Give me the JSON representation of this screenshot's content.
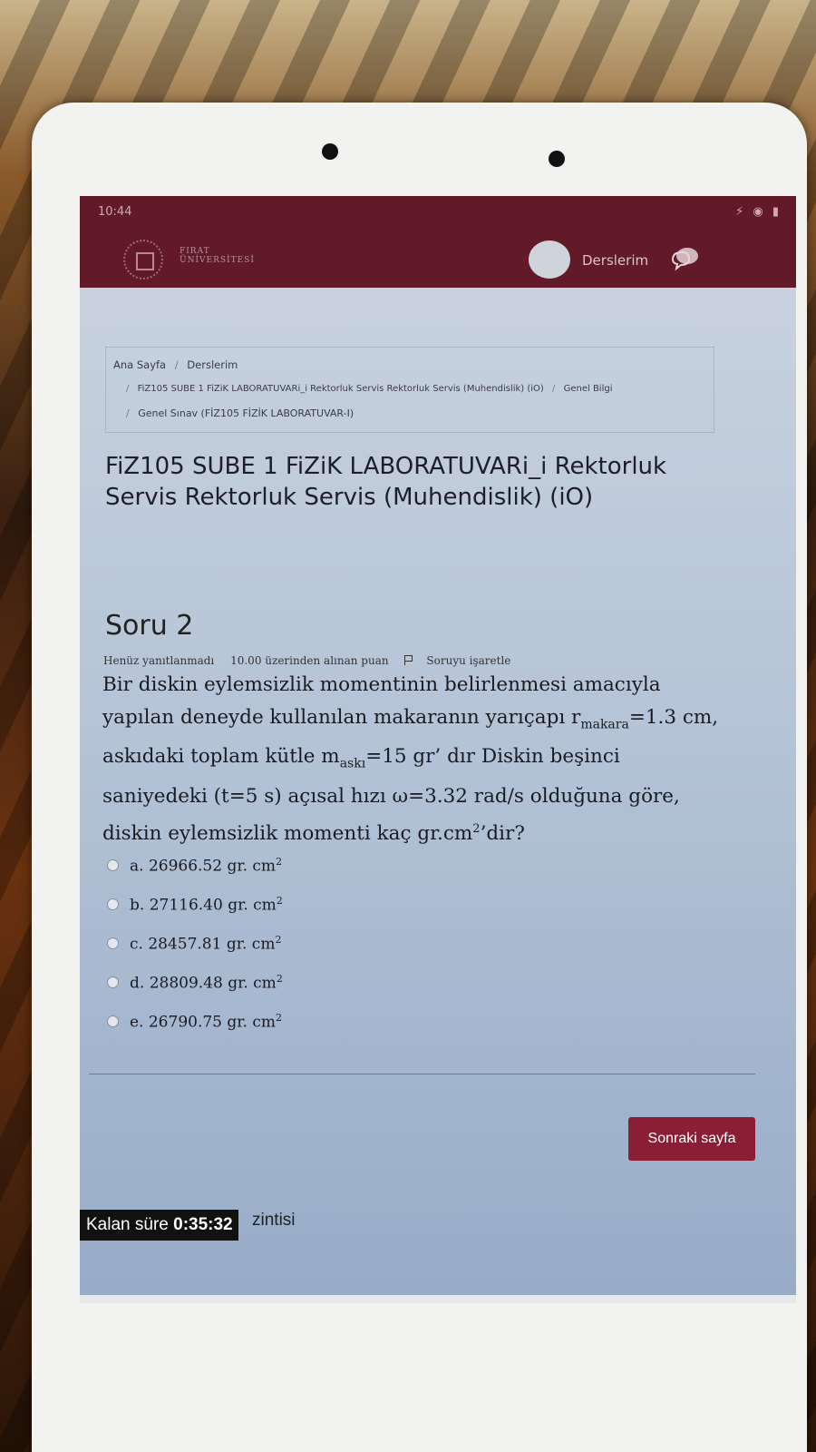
{
  "status_bar": {
    "time": "10:44",
    "icons": "⚡ ◉ ▮"
  },
  "header": {
    "logo_text_line1": "FIRAT",
    "logo_text_line2": "ÜNİVERSİTESİ",
    "courses_link": "Derslerim"
  },
  "breadcrumb": {
    "home": "Ana Sayfa",
    "courses": "Derslerim",
    "course": "FiZ105 SUBE 1 FiZiK LABORATUVARi_i Rektorluk Servis Rektorluk Servis (Muhendislik) (iO)",
    "section": "Genel Bilgi",
    "exam": "Genel Sınav (FİZ105 FİZİK LABORATUVAR-I)",
    "separator": "/"
  },
  "course_title": "FiZ105 SUBE 1 FiZiK LABORATUVARi_i Rektorluk Servis Rektorluk Servis (Muhendislik) (iO)",
  "question": {
    "number_label": "Soru 2",
    "status": "Henüz yanıtlanmadı",
    "points": "10.00 üzerinden alınan puan",
    "flag_label": "Soruyu işaretle",
    "text_part1": "Bir diskin eylemsizlik momentinin belirlenmesi amacıyla yapılan deneyde kullanılan makaranın yarıçapı r",
    "sub_makara": "makara",
    "text_part2": "=1.3 cm, askıdaki toplam kütle m",
    "sub_aski": "askı",
    "text_part3": "=15 gr’ dır Diskin beşinci saniyedeki (t=5 s) açısal hızı ω=3.32 rad/s olduğuna göre, diskin eylemsizlik momenti kaç gr.cm",
    "sup_2": "2",
    "text_part4": "’dir?"
  },
  "answers": [
    {
      "label": "a. 26966.52 gr. cm",
      "sup": "2"
    },
    {
      "label": "b. 27116.40 gr. cm",
      "sup": "2"
    },
    {
      "label": "c. 28457.81 gr. cm",
      "sup": "2"
    },
    {
      "label": "d. 28809.48 gr. cm",
      "sup": "2"
    },
    {
      "label": "e. 26790.75 gr. cm",
      "sup": "2"
    }
  ],
  "next_button": "Sonraki sayfa",
  "timer": {
    "label": "Kalan süre",
    "value": "0:35:32"
  },
  "timer_behind_text": "zintisi",
  "android_nav": {
    "recent": "|||",
    "back": "‹"
  },
  "colors": {
    "brand": "#621a28",
    "button": "#8a1e34"
  }
}
